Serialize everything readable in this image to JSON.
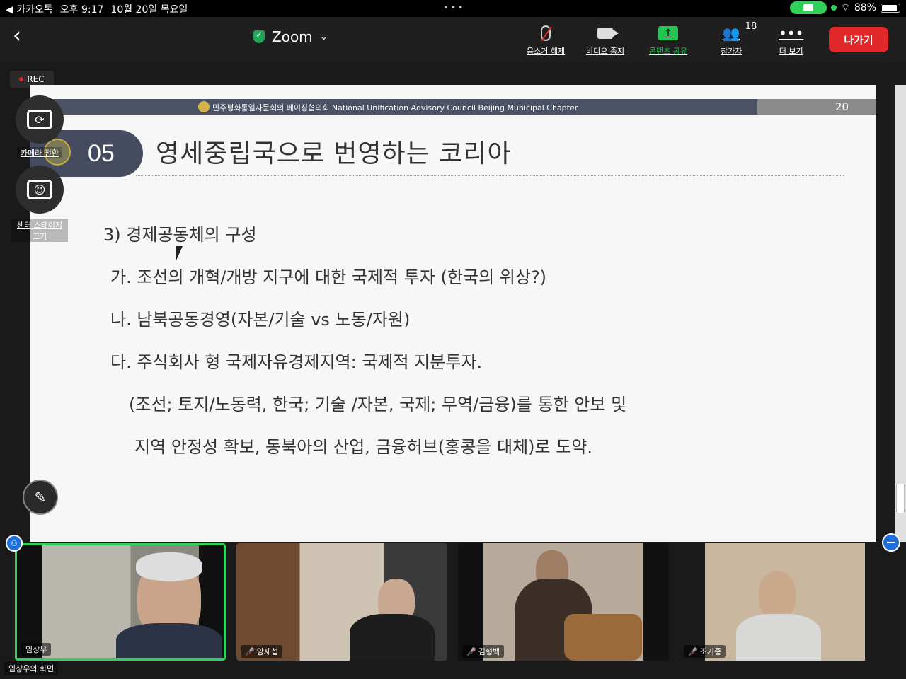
{
  "status_bar": {
    "back_app": "◀ 카카오톡",
    "time": "오후 9:17",
    "date": "10월 20일 목요일",
    "battery": "88%"
  },
  "toolbar": {
    "title": "Zoom",
    "unmute": "음소거 해제",
    "stop_video": "비디오 중지",
    "share_content": "콘텐츠 공유",
    "participants": "참가자",
    "participant_count": "18",
    "more": "더 보기",
    "leave": "나가기"
  },
  "rec_label": "REC",
  "overlay": {
    "switch_camera": "카메라 전환",
    "center_stage_line1": "센터 스테이지",
    "center_stage_line2": "끄기"
  },
  "slide": {
    "header_text": "민주평화통일자문회의 베이징협의회 National Unification Advisory Council Beijing Municipal Chapter",
    "page_number": "20",
    "section_number": "05",
    "title": "영세중립국으로 번영하는 코리아",
    "lines": [
      "3) 경제공동체의 구성",
      "가. 조선의 개혁/개방 지구에 대한 국제적 투자 (한국의 위상?)",
      "나. 남북공동경영(자본/기술 vs 노동/자원)",
      "다. 주식회사 형 국제자유경제지역: 국제적 지분투자.",
      "(조선; 토지/노동력, 한국; 기술 /자본, 국제; 무역/금융)를 통한 안보 및",
      "지역 안정성 확보, 동북아의 산업, 금융허브(홍콩을 대체)로 도약."
    ]
  },
  "participants": [
    {
      "name": "임상우",
      "muted": false
    },
    {
      "name": "양재섭",
      "muted": true
    },
    {
      "name": "김형백",
      "muted": true
    },
    {
      "name": "조기종",
      "muted": true
    }
  ],
  "share_owner": "임상우의 화면",
  "colors": {
    "accent_green": "#30d158",
    "leave_red": "#e02828",
    "slide_header": "#4b5266"
  }
}
